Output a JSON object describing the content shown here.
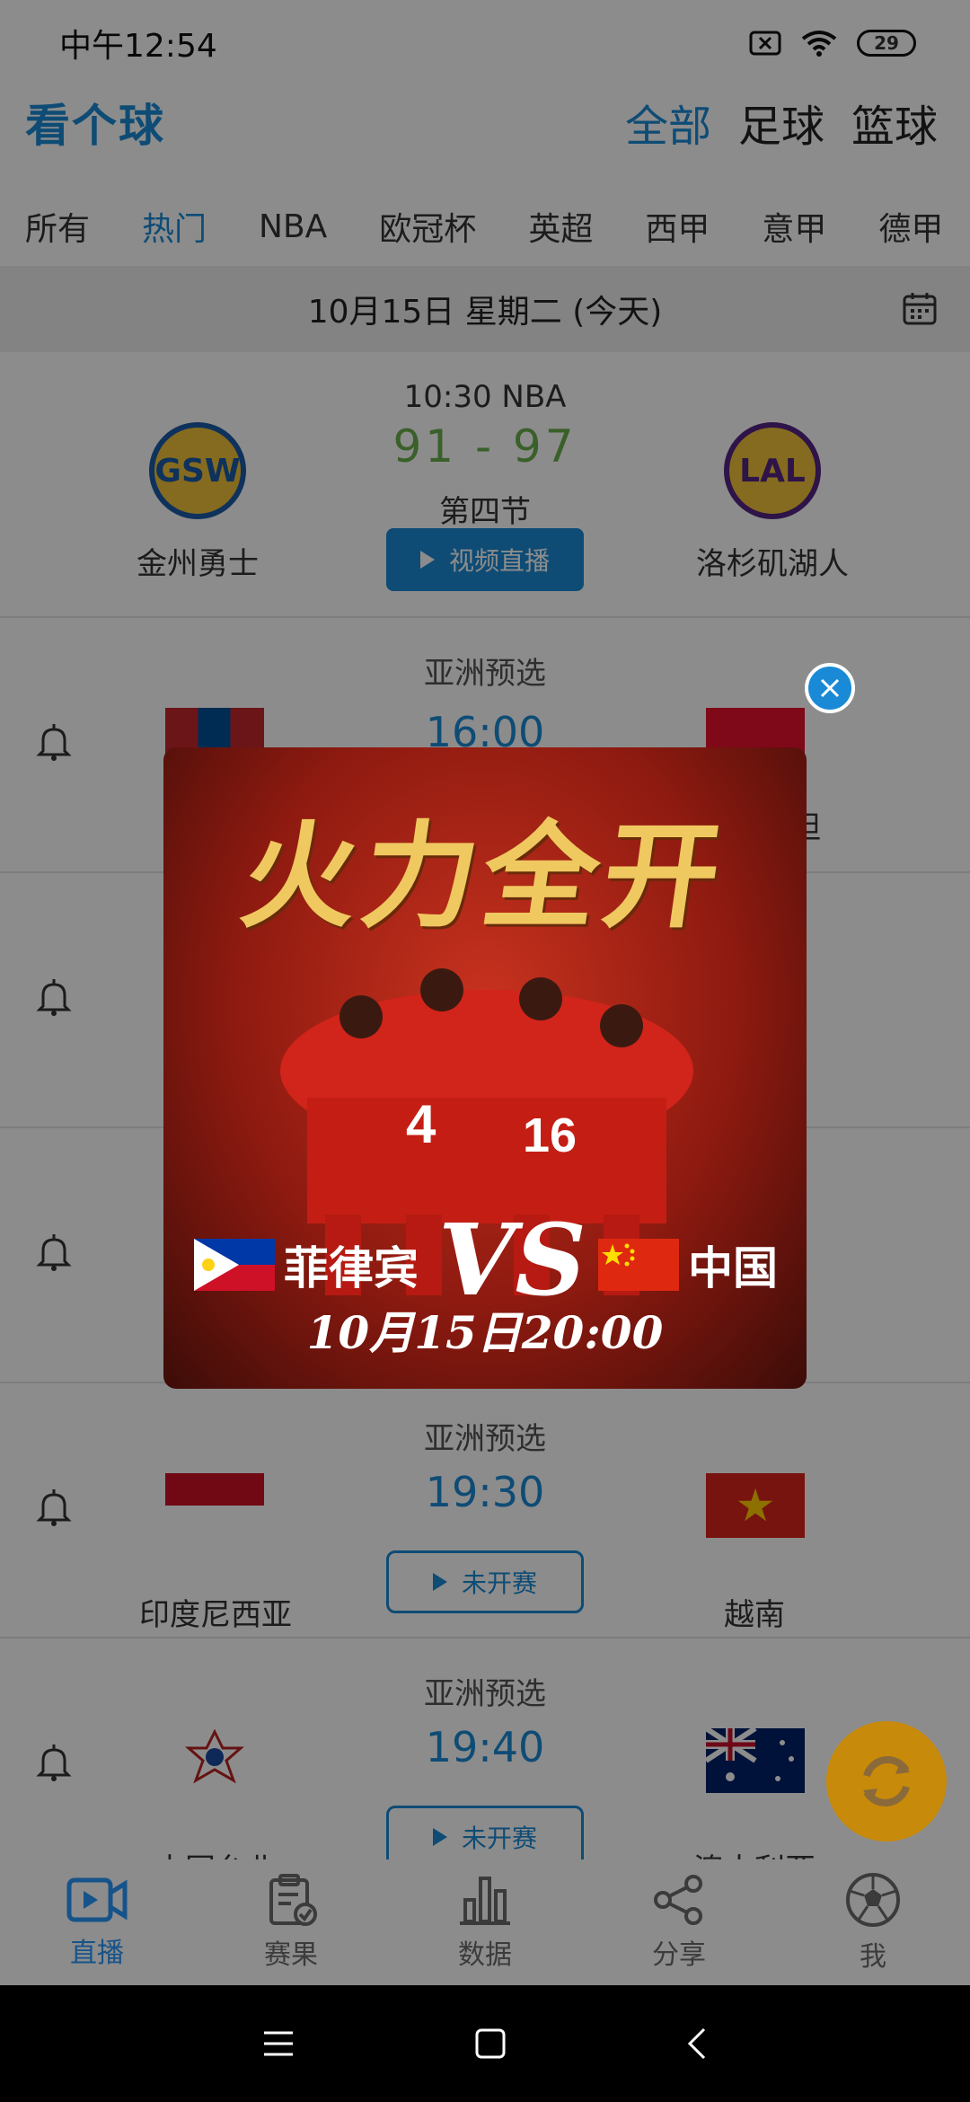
{
  "status_bar": {
    "time": "中午12:54",
    "battery": "29"
  },
  "header": {
    "logo": "看个球",
    "sport_tabs": [
      "全部",
      "足球",
      "篮球"
    ]
  },
  "league_tabs": [
    "所有",
    "热门",
    "NBA",
    "欧冠杯",
    "英超",
    "西甲",
    "意甲",
    "德甲"
  ],
  "date_bar": {
    "text": "10月15日 星期二 (今天)"
  },
  "nba_match": {
    "time": "10:30 NBA",
    "score_home": "91",
    "score_sep": "-",
    "score_away": "97",
    "period": "第四节",
    "live_label": "视频直播",
    "home": {
      "abbr": "GSW",
      "name": "金州勇士"
    },
    "away": {
      "abbr": "LAL",
      "name": "洛杉矶湖人"
    }
  },
  "matches": [
    {
      "league": "亚洲预选",
      "time": "16:00",
      "home": "",
      "away": "斯坦",
      "btn": ""
    },
    {
      "league": "亚洲预选",
      "time": "19:30",
      "home": "印度尼西亚",
      "away": "越南",
      "btn": "未开赛"
    },
    {
      "league": "亚洲预选",
      "time": "19:40",
      "home": "中国台北",
      "away": "澳大利亚",
      "btn": "未开赛"
    }
  ],
  "promo": {
    "title": "火力全开",
    "home": "菲律宾",
    "vs": "VS",
    "away": "中国",
    "datetime": "10月15日20:00"
  },
  "bottom_nav": [
    "直播",
    "赛果",
    "数据",
    "分享",
    "我"
  ],
  "colors": {
    "accent": "#1a8ad6",
    "score": "#6ab04c",
    "fab": "#c88a0a"
  }
}
